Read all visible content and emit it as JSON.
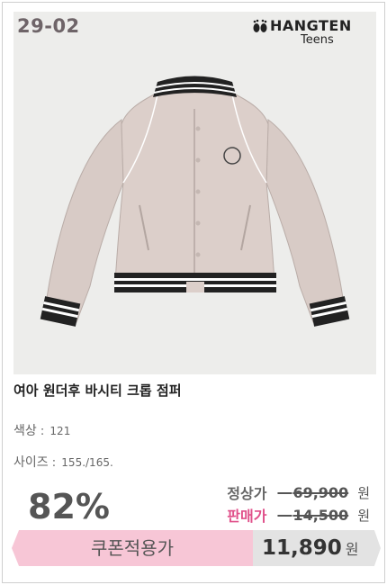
{
  "product_code": "29-02",
  "brand": {
    "name": "HANGTEN",
    "line": "Teens"
  },
  "product": {
    "name": "여아 원더후 바시티 크롭 점퍼",
    "color_label": "색상",
    "color_value": "121",
    "size_label": "사이즈",
    "size_value": "155./165."
  },
  "pricing": {
    "discount": "82%",
    "regular_label": "정상가",
    "regular_price": "69,900",
    "sale_label": "판매가",
    "sale_price": "14,500",
    "currency": "원",
    "coupon_label": "쿠폰적용가",
    "coupon_price": "11,890"
  },
  "colors": {
    "jacket": "#d9ccc7",
    "sale_accent": "#e0508a",
    "coupon_pink": "#f7c6d6"
  }
}
